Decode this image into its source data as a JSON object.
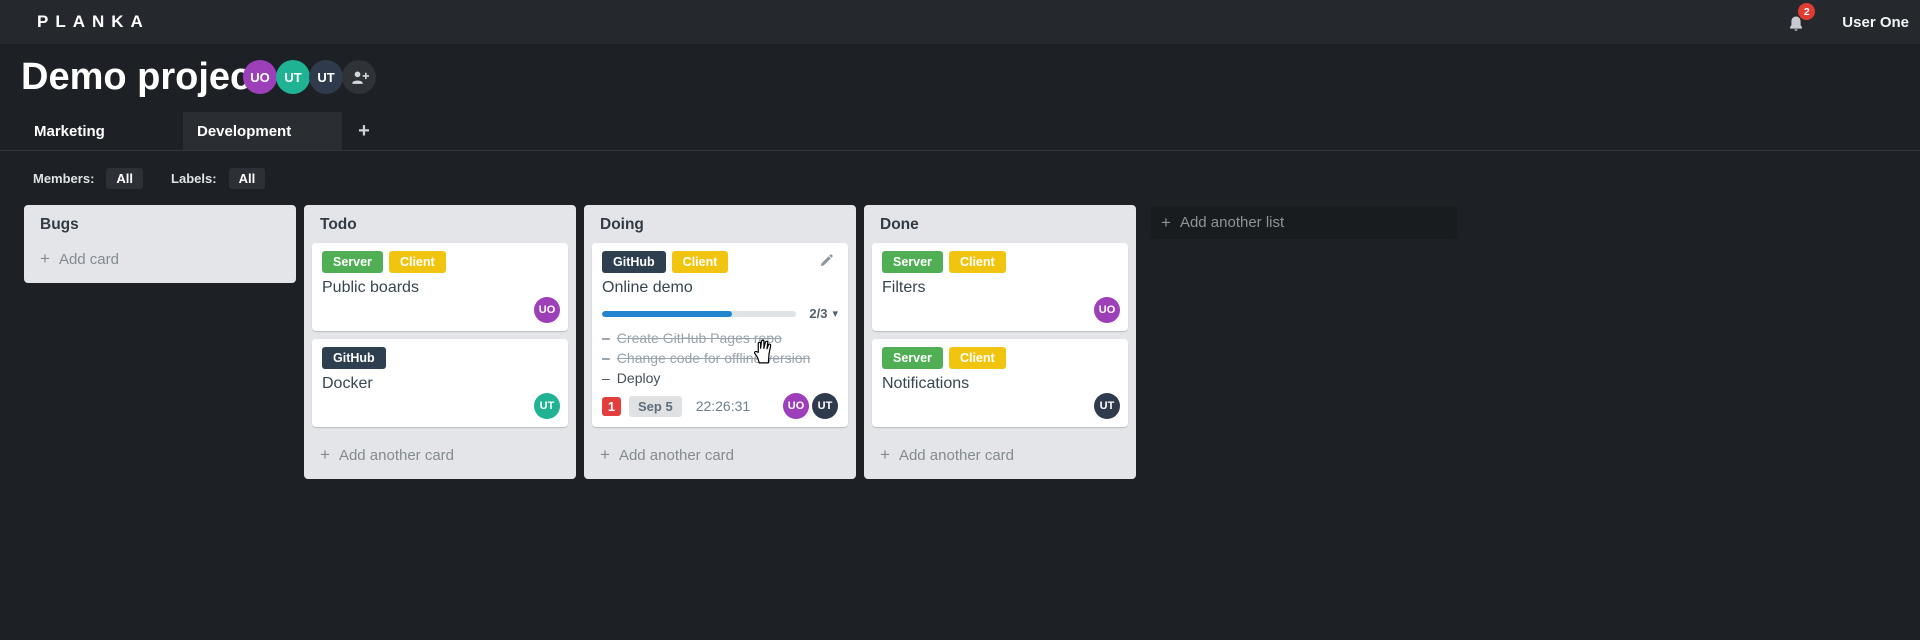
{
  "app": {
    "logo": "PLANKA",
    "notifications_count": "2",
    "user_name": "User One"
  },
  "project": {
    "title": "Demo project",
    "members": [
      {
        "initials": "UO",
        "color": "#9c3fb8"
      },
      {
        "initials": "UT",
        "color": "#1fb394"
      },
      {
        "initials": "UT",
        "color": "#2f3b4c"
      }
    ]
  },
  "boards": {
    "tabs": [
      {
        "label": "Marketing",
        "active": false
      },
      {
        "label": "Development",
        "active": true
      }
    ],
    "add_label": "+"
  },
  "filters": {
    "members_label": "Members:",
    "members_value": "All",
    "labels_label": "Labels:",
    "labels_value": "All"
  },
  "lists": [
    {
      "name": "Bugs",
      "add_label": "Add card",
      "cards": []
    },
    {
      "name": "Todo",
      "add_label": "Add another card",
      "cards": [
        {
          "title": "Public boards",
          "labels": [
            {
              "text": "Server",
              "color": "#50af55"
            },
            {
              "text": "Client",
              "color": "#f0c40f"
            }
          ],
          "members": [
            {
              "initials": "UO",
              "color": "#9c3fb8"
            }
          ]
        },
        {
          "title": "Docker",
          "labels": [
            {
              "text": "GitHub",
              "color": "#2e3f50"
            }
          ],
          "members": [
            {
              "initials": "UT",
              "color": "#1fb394"
            }
          ]
        }
      ]
    },
    {
      "name": "Doing",
      "add_label": "Add another card",
      "cards": [
        {
          "title": "Online demo",
          "labels": [
            {
              "text": "GitHub",
              "color": "#2e3f50"
            },
            {
              "text": "Client",
              "color": "#f0c40f"
            }
          ],
          "has_edit_icon": true,
          "progress": {
            "done": 2,
            "total": 3,
            "label": "2/3",
            "bar_color": "#2185d0"
          },
          "tasks": [
            {
              "text": "Create GitHub Pages repo",
              "completed": true
            },
            {
              "text": "Change code for offline version",
              "completed": true
            },
            {
              "text": "Deploy",
              "completed": false
            }
          ],
          "notification_count": "1",
          "due_date": "Sep 5",
          "timer": "22:26:31",
          "members": [
            {
              "initials": "UO",
              "color": "#9c3fb8"
            },
            {
              "initials": "UT",
              "color": "#2f3b4c"
            }
          ]
        }
      ]
    },
    {
      "name": "Done",
      "add_label": "Add another card",
      "cards": [
        {
          "title": "Filters",
          "labels": [
            {
              "text": "Server",
              "color": "#50af55"
            },
            {
              "text": "Client",
              "color": "#f0c40f"
            }
          ],
          "members": [
            {
              "initials": "UO",
              "color": "#9c3fb8"
            }
          ]
        },
        {
          "title": "Notifications",
          "labels": [
            {
              "text": "Server",
              "color": "#50af55"
            },
            {
              "text": "Client",
              "color": "#f0c40f"
            }
          ],
          "members": [
            {
              "initials": "UT",
              "color": "#2f3b4c"
            }
          ]
        }
      ]
    }
  ],
  "add_list": {
    "label": "Add another list"
  },
  "ui": {
    "plus": "+",
    "caret_down": "▾",
    "task_dash": "–"
  },
  "colors": {
    "notification_badge": "#e03c31",
    "card_notification_badge": "#e13e3c",
    "progress_bar": "#2185d0"
  }
}
